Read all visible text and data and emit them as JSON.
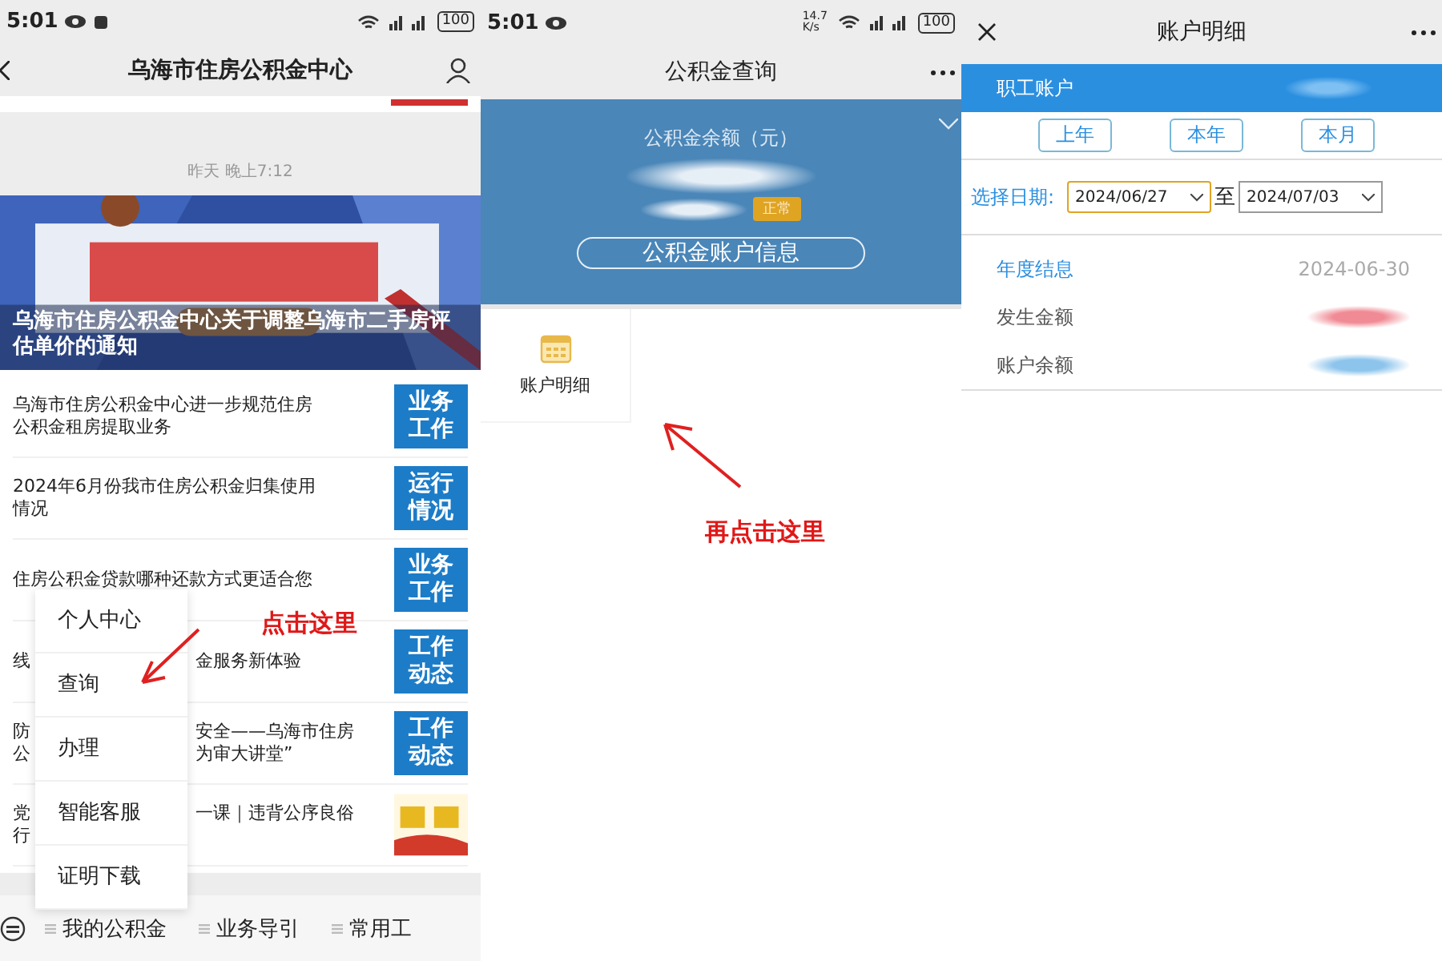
{
  "left_screen": {
    "status_bar": {
      "time": "5:01",
      "battery": "100"
    },
    "title": "乌海市住房公积金中心",
    "timestamp": "昨天 晚上7:12",
    "banner": {
      "kind": "picture",
      "caption": "乌海市住房公积金中心关于调整乌海市二手房评估单价的通知"
    },
    "articles": [
      {
        "kind": "full",
        "lines": [
          "乌海市住房公积金中心进一步规范住房",
          "公积金租房提取业务"
        ],
        "tag": {
          "kind": "label",
          "text": "业务工作"
        }
      },
      {
        "kind": "full",
        "lines": [
          "2024年6月份我市住房公积金归集使用",
          "情况"
        ],
        "tag": {
          "kind": "label",
          "text": "运行情况"
        }
      },
      {
        "kind": "full",
        "lines": [
          "住房公积金贷款哪种还款方式更适合您"
        ],
        "tag": {
          "kind": "label",
          "text": "业务工作"
        }
      },
      {
        "kind": "covered",
        "left_lines": [
          "线"
        ],
        "right_lines": [
          "金服务新体验"
        ],
        "tag": {
          "kind": "label",
          "text": "工作动态"
        }
      },
      {
        "kind": "covered",
        "left_lines": [
          "防",
          "公"
        ],
        "right_lines": [
          "安全——乌海市住房",
          "为审大讲堂”"
        ],
        "tag": {
          "kind": "label",
          "text": "工作动态"
        }
      },
      {
        "kind": "covered",
        "left_lines": [
          "党",
          "行"
        ],
        "right_lines": [
          "一课｜违背公序良俗"
        ],
        "tag": {
          "kind": "picture"
        }
      }
    ],
    "menu": [
      "个人中心",
      "查询",
      "办理",
      "智能客服",
      "证明下载"
    ],
    "bottom_nav": [
      "我的公积金",
      "业务导引",
      "常用工"
    ],
    "annotation": "点击这里"
  },
  "middle_screen": {
    "status_bar": {
      "time": "5:01",
      "speed": "14.7 K/s",
      "battery": "100"
    },
    "title": "公积金查询",
    "balance_label": "公积金余额（元）",
    "status_badge": "正常",
    "account_info_button": "公积金账户信息",
    "tiles": [
      "账户明细"
    ],
    "annotation": "再点击这里"
  },
  "right_screen": {
    "title": "账户明细",
    "account_label": "职工账户",
    "period_buttons": [
      "上年",
      "本年",
      "本月"
    ],
    "date_label": "选择日期:",
    "date_fields": [
      {
        "value": "2024/06/27",
        "focused": true
      },
      {
        "value": "2024/07/03",
        "focused": false
      }
    ],
    "date_separator": "至",
    "rows": [
      {
        "kind": "text",
        "label": "年度结息",
        "value": "2024-06-30"
      },
      {
        "kind": "blurred",
        "label": "发生金额",
        "color": "#f08a94"
      },
      {
        "kind": "blurred",
        "label": "账户余额",
        "color": "#8cc4ec"
      }
    ]
  }
}
